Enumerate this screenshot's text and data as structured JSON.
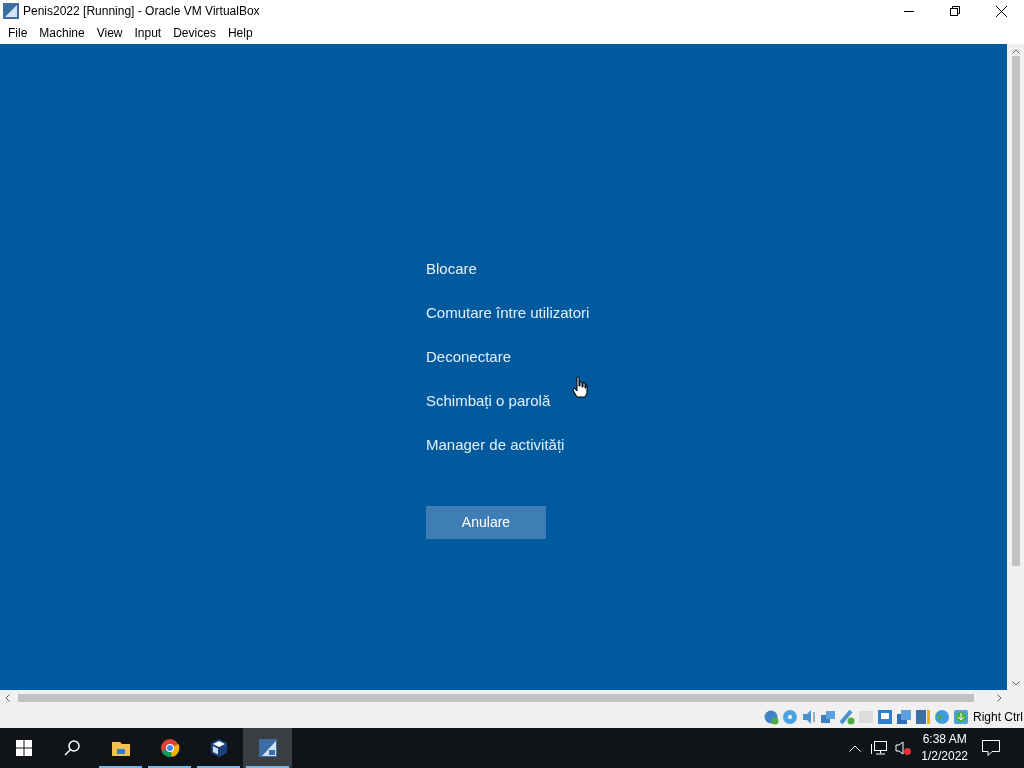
{
  "window": {
    "title": "Penis2022 [Running] - Oracle VM VirtualBox"
  },
  "menu": [
    "File",
    "Machine",
    "View",
    "Input",
    "Devices",
    "Help"
  ],
  "options": [
    "Blocare",
    "Comutare între utilizatori",
    "Deconectare",
    "Schimbați o parolă",
    "Manager de activități"
  ],
  "cancel_button": "Anulare",
  "status_bar": {
    "host_key": "Right Ctrl"
  },
  "taskbar": {
    "apps": [
      {
        "kind": "folder",
        "running": true,
        "selected": false
      },
      {
        "kind": "chrome",
        "running": true,
        "selected": false
      },
      {
        "kind": "cube",
        "running": true,
        "selected": false
      },
      {
        "kind": "vm",
        "running": true,
        "selected": true
      }
    ],
    "time": "6:38 AM",
    "date": "1/2/2022"
  }
}
